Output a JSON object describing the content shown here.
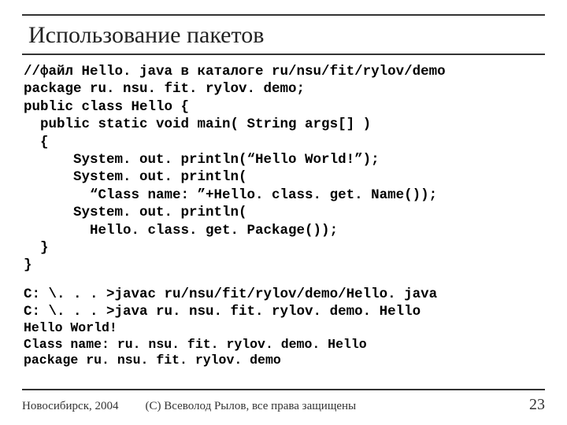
{
  "title": "Использование пакетов",
  "code_lines": [
    "//файл Hello. java в каталоге ru/nsu/fit/rylov/demo",
    "package ru. nsu. fit. rylov. demo;",
    "public class Hello {",
    "  public static void main( String args[] )",
    "  {",
    "      System. out. println(“Hello World!”);",
    "      System. out. println(",
    "        “Class name: ”+Hello. class. get. Name());",
    "      System. out. println(",
    "        Hello. class. get. Package());",
    "  }",
    "}"
  ],
  "shell_lines": [
    "C: \\. . . >javac ru/nsu/fit/rylov/demo/Hello. java",
    "C: \\. . . >java ru. nsu. fit. rylov. demo. Hello"
  ],
  "output_lines": [
    "Hello World!",
    "Class name: ru. nsu. fit. rylov. demo. Hello",
    "package ru. nsu. fit. rylov. demo"
  ],
  "footer": {
    "place": "Новосибирск, 2004",
    "copyright": "(С) Всеволод Рылов, все права защищены",
    "page": "23"
  }
}
